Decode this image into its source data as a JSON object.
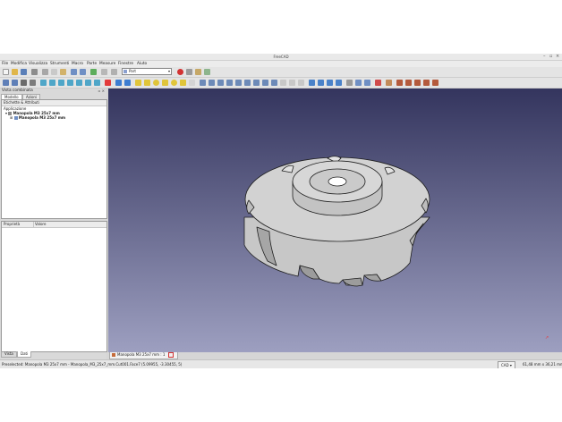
{
  "window": {
    "title": "FreeCAD"
  },
  "menu": [
    "File",
    "Modifica",
    "Visualizza",
    "Strumenti",
    "Macro",
    "Parte",
    "Measure",
    "Finestre",
    "Aiuto"
  ],
  "toolbar": {
    "workbench": "Part"
  },
  "combo_view": {
    "title": "Vista combinata",
    "tabs": [
      "Modello",
      "Azioni"
    ],
    "tree_header": "Etichette & Attributi",
    "application_label": "Applicazione",
    "document": "Manopola M3 25x7 mm",
    "object": "Manopola M3 25x7 mm",
    "property_columns": [
      "Proprietà",
      "Valore"
    ],
    "bottom_tabs": [
      "Vista",
      "Dati"
    ]
  },
  "document_tab": {
    "label": "Manopola M3 25x7 mm : 1"
  },
  "status": {
    "message": "Preselected: Manopola M3 25x7 mm - Manopola_M3_25x7_mm.Cut001.Face7 (5.09955, -3.30455, 5)",
    "nav_style": "CAD",
    "dimensions": "61,48 mm x 36,21 mm"
  },
  "colors": {
    "viewport_top": "#34355e",
    "viewport_bottom": "#9d9fc0",
    "knob_face": "#cbcbcb",
    "knob_edge": "#1f1f1f"
  },
  "icons": [
    "new-file-icon",
    "open-icon",
    "save-icon",
    "print-icon",
    "cut-icon",
    "copy-icon",
    "paste-icon",
    "undo-icon",
    "redo-icon",
    "refresh-icon",
    "pointer-icon",
    "macro-record-icon",
    "macro-stop-icon",
    "macro-run-icon",
    "fit-all-icon",
    "view-front-icon",
    "view-top-icon",
    "view-right-icon",
    "box-icon",
    "cylinder-icon",
    "sphere-icon",
    "cone-icon",
    "torus-icon",
    "boolean-icon",
    "axis-cross-icon"
  ]
}
